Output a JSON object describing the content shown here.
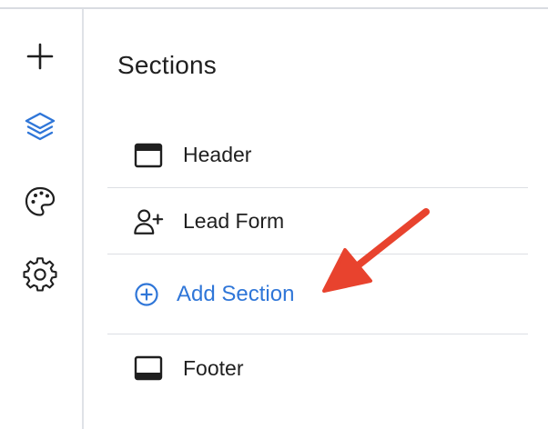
{
  "rail": {
    "items": [
      {
        "name": "plus-icon",
        "color": "#1f1f1f"
      },
      {
        "name": "layers-icon",
        "color": "#2f76d8"
      },
      {
        "name": "palette-icon",
        "color": "#1f1f1f"
      },
      {
        "name": "gear-icon",
        "color": "#1f1f1f"
      }
    ]
  },
  "panel": {
    "title": "Sections",
    "sections": [
      {
        "label": "Header",
        "icon": "header-layout-icon"
      },
      {
        "label": "Lead Form",
        "icon": "add-user-icon"
      },
      {
        "label": "Add Section",
        "icon": "plus-circle-icon"
      },
      {
        "label": "Footer",
        "icon": "footer-layout-icon"
      }
    ]
  },
  "annotation": {
    "arrow_color": "#e8432e",
    "points_to": "Add Section"
  },
  "colors": {
    "accent": "#2f76d8",
    "text": "#1f1f1f",
    "divider": "#dcdfe4"
  }
}
